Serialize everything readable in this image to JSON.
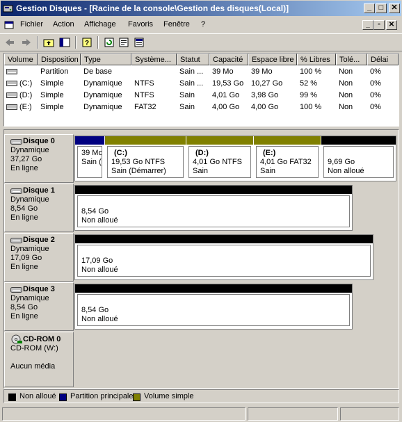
{
  "window": {
    "title": "Gestion Disques - [Racine de la console\\Gestion des disques(Local)]"
  },
  "menu": [
    {
      "label": "Fichier"
    },
    {
      "label": "Action"
    },
    {
      "label": "Affichage"
    },
    {
      "label": "Favoris"
    },
    {
      "label": "Fenêtre"
    },
    {
      "label": "?"
    }
  ],
  "list": {
    "columns": [
      "Volume",
      "Disposition",
      "Type",
      "Système...",
      "Statut",
      "Capacité",
      "Espace libre",
      "% Libres",
      "Tolé...",
      "Délai"
    ],
    "rows": [
      [
        "",
        "Partition",
        "De base",
        "",
        "Sain ...",
        "39 Mo",
        "39 Mo",
        "100 %",
        "Non",
        "0%"
      ],
      [
        "(C:)",
        "Simple",
        "Dynamique",
        "NTFS",
        "Sain ...",
        "19,53 Go",
        "10,27 Go",
        "52 %",
        "Non",
        "0%"
      ],
      [
        "(D:)",
        "Simple",
        "Dynamique",
        "NTFS",
        "Sain",
        "4,01 Go",
        "3,98 Go",
        "99 %",
        "Non",
        "0%"
      ],
      [
        "(E:)",
        "Simple",
        "Dynamique",
        "FAT32",
        "Sain",
        "4,00 Go",
        "4,00 Go",
        "100 %",
        "Non",
        "0%"
      ]
    ]
  },
  "disks": [
    {
      "name": "Disque 0",
      "type": "Dynamique",
      "size": "37,27 Go",
      "status": "En ligne",
      "partitions": [
        {
          "label": "",
          "line1": "39 Mo",
          "line2": "Sain (",
          "kind": "primary"
        },
        {
          "label": "(C:)",
          "line1": "19,53 Go NTFS",
          "line2": "Sain (Démarrer)",
          "kind": "simple"
        },
        {
          "label": "(D:)",
          "line1": "4,01 Go NTFS",
          "line2": "Sain",
          "kind": "simple"
        },
        {
          "label": "(E:)",
          "line1": "4,01 Go FAT32",
          "line2": "Sain",
          "kind": "simple"
        },
        {
          "label": "",
          "line1": "9,69 Go",
          "line2": "Non alloué",
          "kind": "unallocated"
        }
      ]
    },
    {
      "name": "Disque 1",
      "type": "Dynamique",
      "size": "8,54 Go",
      "status": "En ligne",
      "partitions": [
        {
          "line1": "8,54 Go",
          "line2": "Non alloué",
          "kind": "unallocated"
        }
      ]
    },
    {
      "name": "Disque 2",
      "type": "Dynamique",
      "size": "17,09 Go",
      "status": "En ligne",
      "partitions": [
        {
          "line1": "17,09 Go",
          "line2": "Non alloué",
          "kind": "unallocated"
        }
      ]
    },
    {
      "name": "Disque 3",
      "type": "Dynamique",
      "size": "8,54 Go",
      "status": "En ligne",
      "partitions": [
        {
          "line1": "8,54 Go",
          "line2": "Non alloué",
          "kind": "unallocated"
        }
      ]
    }
  ],
  "cdrom": {
    "name": "CD-ROM 0",
    "drive": "CD-ROM (W:)",
    "status": "Aucun média"
  },
  "legend": [
    {
      "label": "Non alloué",
      "color": "#000000"
    },
    {
      "label": "Partition principale",
      "color": "#000080"
    },
    {
      "label": "Volume simple",
      "color": "#808000"
    }
  ],
  "icons": {
    "app": "disk-management-icon",
    "back": "back-arrow-icon",
    "forward": "forward-arrow-icon",
    "up": "up-folder-icon",
    "tree": "show-tree-icon",
    "help": "help-icon",
    "refresh": "refresh-icon",
    "properties": "properties-icon",
    "export": "export-list-icon",
    "disk": "hard-disk-icon",
    "cdrom": "cdrom-icon"
  }
}
